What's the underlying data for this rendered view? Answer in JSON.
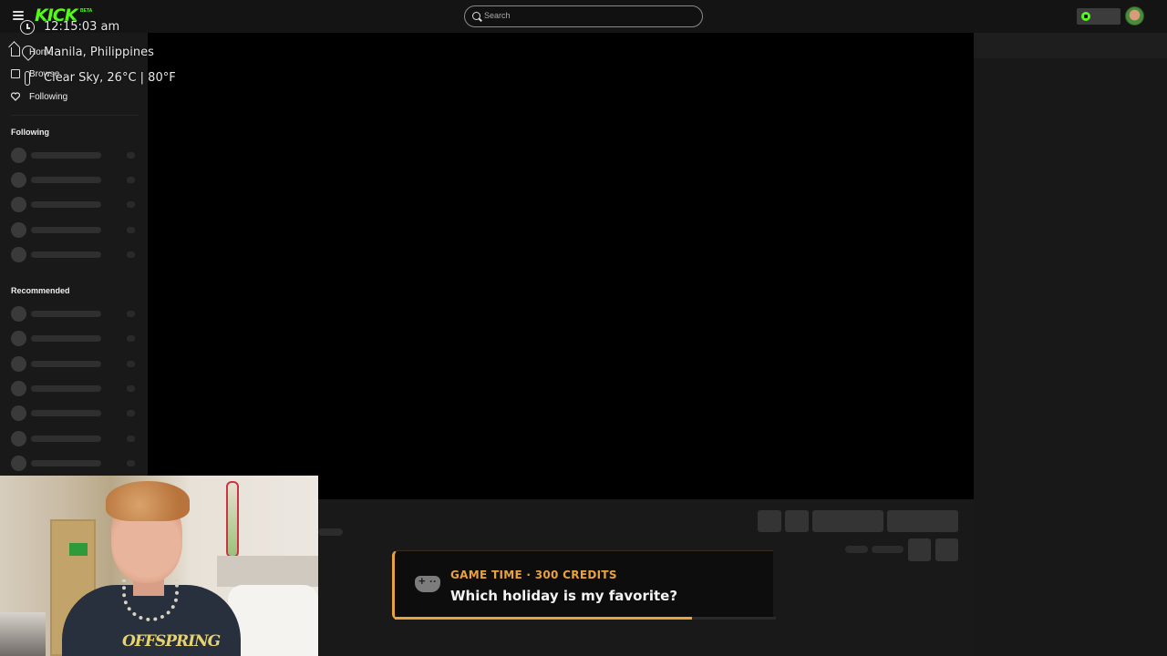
{
  "header": {
    "logo_text": "KICK",
    "logo_badge": "BETA",
    "search": {
      "placeholder": "Search"
    },
    "brand_color": "#53fc18"
  },
  "overlay": {
    "time": "12:15:03 am",
    "location": "Manila, Philippines",
    "weather": "Clear Sky, 26°C | 80°F"
  },
  "sidebar": {
    "nav": [
      {
        "label": "Home",
        "icon": "home-icon"
      },
      {
        "label": "Browse",
        "icon": "browse-icon"
      },
      {
        "label": "Following",
        "icon": "heart-icon"
      }
    ],
    "following_title": "Following",
    "recommended_title": "Recommended"
  },
  "notification": {
    "title": "GAME TIME · 300 CREDITS",
    "question": "Which holiday is my favorite?",
    "icon": "gamepad-icon",
    "accent_color": "#e8a33c",
    "progress": 0.78
  },
  "webcam": {
    "shirt_text": "OFFSPRING"
  }
}
